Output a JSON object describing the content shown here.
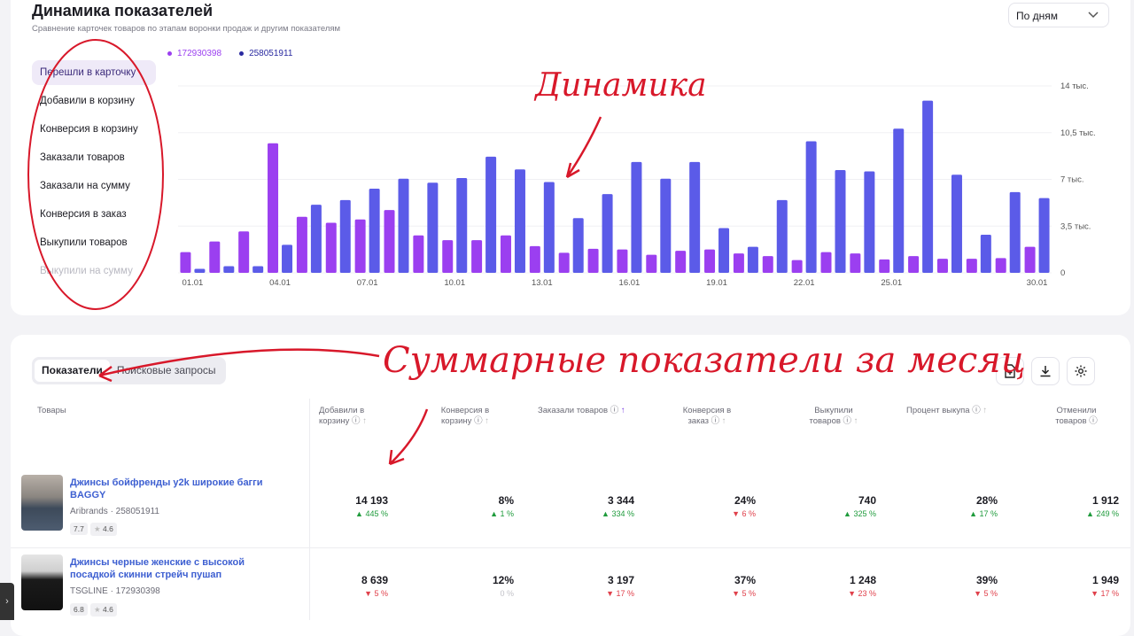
{
  "header": {
    "title": "Динамика показателей",
    "subtitle": "Сравнение карточек товаров по этапам воронки продаж и другим показателям",
    "period_select": "По дням"
  },
  "metrics": [
    {
      "label": "Перешли в карточку",
      "active": true
    },
    {
      "label": "Добавили в корзину"
    },
    {
      "label": "Конверсия в корзину"
    },
    {
      "label": "Заказали товаров"
    },
    {
      "label": "Заказали на сумму"
    },
    {
      "label": "Конверсия в заказ"
    },
    {
      "label": "Выкупили товаров"
    },
    {
      "label": "Выкупили на сумму",
      "faded": true
    }
  ],
  "colors": {
    "series_a": "#9b3ff0",
    "series_b": "#5b5be8",
    "annotation": "#d8182a",
    "link": "#3d5fd1"
  },
  "chart_data": {
    "type": "bar",
    "categories": [
      "01.01",
      "02.01",
      "03.01",
      "04.01",
      "05.01",
      "06.01",
      "07.01",
      "08.01",
      "09.01",
      "10.01",
      "11.01",
      "12.01",
      "13.01",
      "14.01",
      "15.01",
      "16.01",
      "17.01",
      "18.01",
      "19.01",
      "20.01",
      "21.01",
      "22.01",
      "23.01",
      "24.01",
      "25.01",
      "26.01",
      "27.01",
      "28.01",
      "29.01",
      "30.01"
    ],
    "x_tick_labels": [
      "01.01",
      "04.01",
      "07.01",
      "10.01",
      "13.01",
      "16.01",
      "19.01",
      "22.01",
      "25.01",
      "30.01"
    ],
    "y_tick_labels": [
      "14 тыс.",
      "10,5 тыс.",
      "7 тыс.",
      "3,5 тыс.",
      "0"
    ],
    "ylim": [
      0,
      14000
    ],
    "series": [
      {
        "name": "172930398",
        "values": [
          1550,
          2350,
          3100,
          9700,
          4200,
          3750,
          4000,
          4700,
          2800,
          2450,
          2450,
          2800,
          2000,
          1500,
          1800,
          1750,
          1350,
          1650,
          1750,
          1450,
          1250,
          950,
          1550,
          1450,
          1000,
          1250,
          1050,
          1050,
          1100,
          1950
        ]
      },
      {
        "name": "258051911",
        "values": [
          300,
          500,
          500,
          2100,
          5100,
          5450,
          6300,
          7050,
          6750,
          7100,
          8700,
          7750,
          6800,
          4100,
          5900,
          8300,
          7050,
          8300,
          3350,
          1950,
          5450,
          9850,
          7700,
          7600,
          10800,
          12900,
          7350,
          2850,
          6050,
          5600
        ]
      }
    ]
  },
  "table": {
    "tabs": [
      {
        "label": "Показатели",
        "active": true
      },
      {
        "label": "Поисковые запросы"
      }
    ],
    "columns": [
      {
        "label": "Товары"
      },
      {
        "label": "Добавили в корзину"
      },
      {
        "label": "Конверсия в корзину"
      },
      {
        "label": "Заказали товаров"
      },
      {
        "label": "Конверсия в заказ"
      },
      {
        "label": "Выкупили товаров"
      },
      {
        "label": "Процент выкупа"
      },
      {
        "label": "Отменили товаров"
      }
    ],
    "rows": [
      {
        "name": "Джинсы бойфренды y2k широкие багги BAGGY",
        "brand": "Aribrands · 258051911",
        "score": "7.7",
        "rating": "4.6",
        "cells": [
          {
            "value": "14 193",
            "delta": "445 %",
            "dir": "up"
          },
          {
            "value": "8%",
            "delta": "1 %",
            "dir": "up"
          },
          {
            "value": "3 344",
            "delta": "334 %",
            "dir": "up"
          },
          {
            "value": "24%",
            "delta": "6 %",
            "dir": "down"
          },
          {
            "value": "740",
            "delta": "325 %",
            "dir": "up"
          },
          {
            "value": "28%",
            "delta": "17 %",
            "dir": "up"
          },
          {
            "value": "1 912",
            "delta": "249 %",
            "dir": "up"
          }
        ]
      },
      {
        "name": "Джинсы черные женские с высокой посадкой скинни стрейч пушап",
        "brand": "TSGLINE · 172930398",
        "score": "6.8",
        "rating": "4.6",
        "cells": [
          {
            "value": "8 639",
            "delta": "5 %",
            "dir": "down"
          },
          {
            "value": "12%",
            "delta": "0 %",
            "dir": "neutral"
          },
          {
            "value": "3 197",
            "delta": "17 %",
            "dir": "down"
          },
          {
            "value": "37%",
            "delta": "5 %",
            "dir": "down"
          },
          {
            "value": "1 248",
            "delta": "23 %",
            "dir": "down"
          },
          {
            "value": "39%",
            "delta": "5 %",
            "dir": "down"
          },
          {
            "value": "1 949",
            "delta": "17 %",
            "dir": "down"
          }
        ]
      }
    ]
  },
  "annotations": {
    "chart_note": "Динамика",
    "table_note": "Суммарные показатели за месяц"
  }
}
